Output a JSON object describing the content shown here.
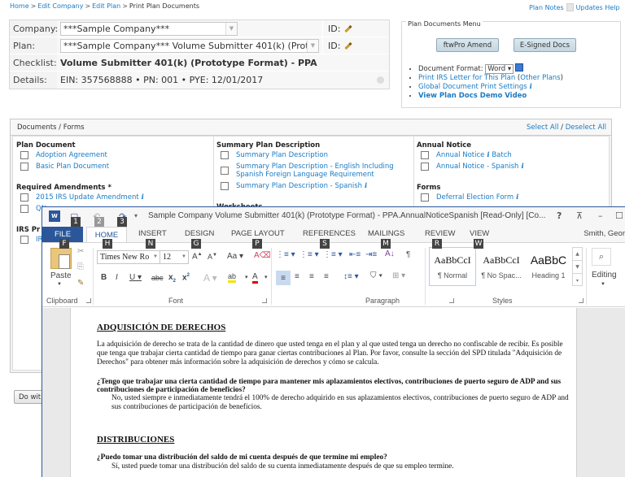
{
  "breadcrumb": [
    {
      "label": "Home",
      "link": true
    },
    {
      "label": "Edit Company",
      "link": true
    },
    {
      "label": "Edit Plan",
      "link": true
    },
    {
      "label": "Print Plan Documents",
      "link": false
    }
  ],
  "breadcrumb_sep": ">",
  "top_links": {
    "plan_notes": "Plan Notes",
    "updates_help": "Updates Help"
  },
  "info": {
    "company_label": "Company:",
    "company_value": "***Sample Company***",
    "plan_label": "Plan:",
    "plan_value": "***Sample Company*** Volume Submitter 401(k) (Protc",
    "id_label": "ID:",
    "checklist_label": "Checklist:",
    "checklist_value": "Volume Submitter 401(k) (Prototype Format) - PPA",
    "details_label": "Details:",
    "details_value": "EIN: 357568888 • PN: 001 • PYE: 12/01/2017"
  },
  "plan_docs_menu": {
    "title": "Plan Documents Menu",
    "btn_amend": "ftwPro Amend",
    "btn_esigned": "E-Signed Docs",
    "doc_format_label": "Document Format:",
    "doc_format_value": "Word",
    "print_irs": "Print IRS Letter for This Plan",
    "other_plans": "Other Plans",
    "global_settings": "Global Document Print Settings",
    "demo_video": "View Plan Docs Demo Video"
  },
  "documents": {
    "title": "Documents / Forms",
    "select_all": "Select All",
    "deselect_all": "Deselect All",
    "columns": [
      {
        "sections": [
          {
            "title": "Plan Document",
            "items": [
              "Adoption Agreement",
              "Basic Plan Document"
            ]
          },
          {
            "title": "Required Amendments *",
            "items": [
              "2015 IRS Update Amendment",
              "QN"
            ]
          },
          {
            "title": "IRS Pr",
            "items": [
              "IR"
            ]
          }
        ]
      },
      {
        "sections": [
          {
            "title": "Summary Plan Description",
            "items": [
              "Summary Plan Description",
              "Summary Plan Description - English Including Spanish Foreign Language Requirement",
              "Summary Plan Description - Spanish"
            ]
          },
          {
            "title": "Worksheets",
            "items": []
          }
        ]
      },
      {
        "sections": [
          {
            "title": "Annual Notice",
            "items": [
              "Annual Notice",
              "Annual Notice - Spanish"
            ]
          },
          {
            "title": "Forms",
            "items": [
              "Deferral Election Form"
            ]
          }
        ]
      }
    ],
    "batch_label": "Batch"
  },
  "do_button": "Do wit",
  "word": {
    "logo": "W",
    "title": "Sample Company Volume Submitter 401(k) (Prototype Format) - PPA.AnnualNoticeSpanish [Read-Only] [Co...",
    "help": "?",
    "user": "Smith, Geor",
    "qa_keytips": [
      "1",
      "2",
      "3"
    ],
    "tabs": [
      {
        "label": "FILE",
        "key": "F"
      },
      {
        "label": "HOME",
        "key": "H"
      },
      {
        "label": "INSERT",
        "key": "N"
      },
      {
        "label": "DESIGN",
        "key": "G"
      },
      {
        "label": "PAGE LAYOUT",
        "key": "P"
      },
      {
        "label": "REFERENCES",
        "key": "S"
      },
      {
        "label": "MAILINGS",
        "key": "M"
      },
      {
        "label": "REVIEW",
        "key": "R"
      },
      {
        "label": "VIEW",
        "key": "W"
      }
    ],
    "ribbon": {
      "paste": "Paste",
      "clipboard": "Clipboard",
      "font_name": "Times New Ro",
      "font_size": "12",
      "font": "Font",
      "paragraph": "Paragraph",
      "styles": "Styles",
      "editing": "Editing",
      "style_items": [
        {
          "sample": "AaBbCcI",
          "name": "¶ Normal"
        },
        {
          "sample": "AaBbCcI",
          "name": "¶ No Spac..."
        },
        {
          "sample": "AaBbC",
          "name": "Heading 1"
        }
      ]
    },
    "doc": {
      "h1": "ADQUISICIÓN DE DERECHOS",
      "p1": "La adquisición de derecho se trata de la cantidad de dinero que usted tenga en el plan y al que usted tenga un derecho no confiscable de recibir. Es posible que tenga que trabajar cierta cantidad de tiempo para ganar ciertas contribuciones al Plan. Por favor, consulte la sección del SPD titulada \"Adquisición de Derechos\" para obtener más información sobre la adquisición de derechos y cómo se calcula.",
      "q1": "¿Tengo que trabajar una cierta cantidad de tiempo para mantener mis aplazamientos electivos, contribuciones de puerto seguro de ADP and sus contribuciones de participación de beneficios?",
      "a1": "No, usted siempre e inmediatamente tendrá el 100% de derecho adquirido en sus aplazamientos electivos, contribuciones de puerto seguro de ADP and sus contribuciones de participación de beneficios.",
      "h2": "DISTRIBUCIONES",
      "q2": "¿Puedo tomar una distribución del saldo de mi cuenta después de que termine mi empleo?",
      "a2": "Sí, usted puede tomar una distribución del saldo de su cuenta inmediatamente después de que su empleo termine."
    }
  }
}
